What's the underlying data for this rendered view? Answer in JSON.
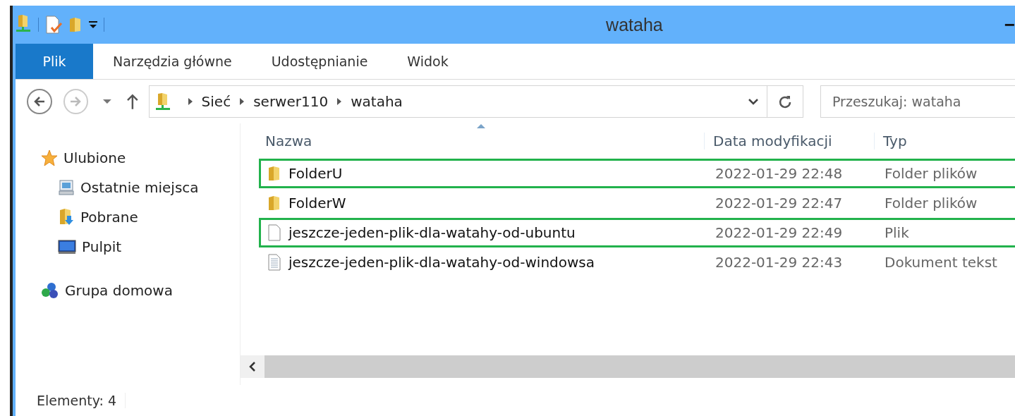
{
  "window": {
    "title": "wataha",
    "minimize": "−"
  },
  "ribbon_tabs": [
    {
      "label": "Plik",
      "selected": true
    },
    {
      "label": "Narzędzia główne",
      "selected": false
    },
    {
      "label": "Udostępnianie",
      "selected": false
    },
    {
      "label": "Widok",
      "selected": false
    }
  ],
  "address_bar": {
    "path": [
      "Sieć",
      "serwer110",
      "wataha"
    ]
  },
  "search": {
    "placeholder": "Przeszukaj: wataha"
  },
  "sidebar": {
    "groups": [
      {
        "label": "Ulubione",
        "kind": "favorites",
        "children": [
          {
            "label": "Ostatnie miejsca",
            "kind": "recent"
          },
          {
            "label": "Pobrane",
            "kind": "downloads"
          },
          {
            "label": "Pulpit",
            "kind": "desktop"
          }
        ]
      },
      {
        "label": "Grupa domowa",
        "kind": "homegroup"
      }
    ]
  },
  "table": {
    "columns": [
      "Nazwa",
      "Data modyfikacji",
      "Typ"
    ],
    "rows": [
      {
        "kind": "folder",
        "name": "FolderU",
        "date": "2022-01-29 22:48",
        "type": "Folder plików",
        "highlighted": true
      },
      {
        "kind": "folder",
        "name": "FolderW",
        "date": "2022-01-29 22:47",
        "type": "Folder plików",
        "highlighted": false
      },
      {
        "kind": "file",
        "name": "jeszcze-jeden-plik-dla-watahy-od-ubuntu",
        "date": "2022-01-29 22:49",
        "type": "Plik",
        "highlighted": true
      },
      {
        "kind": "text",
        "name": "jeszcze-jeden-plik-dla-watahy-od-windowsa",
        "date": "2022-01-29 22:43",
        "type": "Dokument tekst",
        "highlighted": false
      }
    ]
  },
  "status_bar": {
    "text": "Elementy: 4"
  }
}
